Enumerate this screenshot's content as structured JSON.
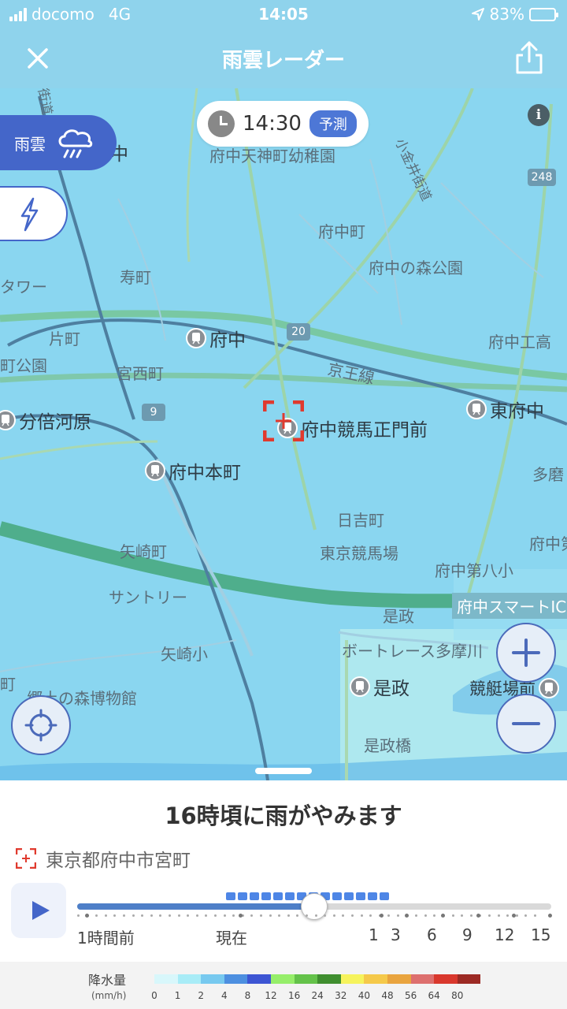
{
  "status_bar": {
    "carrier": "docomo",
    "network": "4G",
    "time": "14:05",
    "battery": "83%",
    "battery_level": 0.83
  },
  "header": {
    "title": "雨雲レーダー"
  },
  "map": {
    "forecast_time": "14:30",
    "forecast_badge": "予測",
    "layer_rain_label": "雨雲",
    "info_label": "i",
    "labels": {
      "fuchu_tenjin": "府中天神町幼稚園",
      "fuchu_cho": "府中町",
      "kotobuki": "寿町",
      "tower": "タワー",
      "fuchu_no_mori": "府中の森公園",
      "katamachi": "片町",
      "machi_koen": "町公園",
      "miyanishi": "宮西町",
      "keio_line": "京王線",
      "fuchu_kogyo": "府中工高",
      "tama": "多磨",
      "hiyoshi": "日吉町",
      "keibajo": "東京競馬場",
      "yazaki": "矢崎町",
      "fuchu_8": "府中第八小",
      "fuchu_right": "府中第",
      "suntory": "サントリー",
      "koremasa_town": "是政",
      "smart_ic": "府中スマートIC",
      "boat_race": "ボートレース多摩川",
      "yazaki_sho": "矢崎小",
      "kyodo_museum": "郷土の森博物館",
      "kyoteijo": "競艇場前",
      "koremasa_bridge": "是政橋",
      "machi_left": "町",
      "chu": "中",
      "kanai": "小金井街道",
      "kaido": "街道"
    },
    "roads": {
      "r20": "20",
      "r9": "9",
      "r248": "248"
    },
    "stations": {
      "fuchu": "府中",
      "higashi_fuchu": "東府中",
      "bubaigawara": "分倍河原",
      "keibajo_seimon": "府中競馬正門前",
      "fuchu_honmachi": "府中本町",
      "koremasa": "是政"
    }
  },
  "sheet": {
    "headline": "16時頃に雨がやみます",
    "location": "東京都府中市宮町",
    "timeline_labels": {
      "past": "1時間前",
      "now": "現在",
      "h1": "1",
      "h3": "3",
      "h6": "6",
      "h9": "9",
      "h12": "12",
      "h15": "15"
    },
    "timeline_position": 0.5,
    "rain_segments": 14
  },
  "legend": {
    "title": "降水量",
    "unit": "(mm/h)",
    "values": [
      "0",
      "1",
      "2",
      "4",
      "8",
      "12",
      "16",
      "24",
      "32",
      "40",
      "48",
      "56",
      "64",
      "80"
    ],
    "colors": [
      "#d8f7fb",
      "#a8ecf7",
      "#77c9ef",
      "#4d8fe0",
      "#3d55d3",
      "#96ee6a",
      "#64c24a",
      "#3f8e2f",
      "#f6f35c",
      "#f5c94a",
      "#e9a43e",
      "#dd6f6e",
      "#d9382d",
      "#9c2a24"
    ]
  }
}
